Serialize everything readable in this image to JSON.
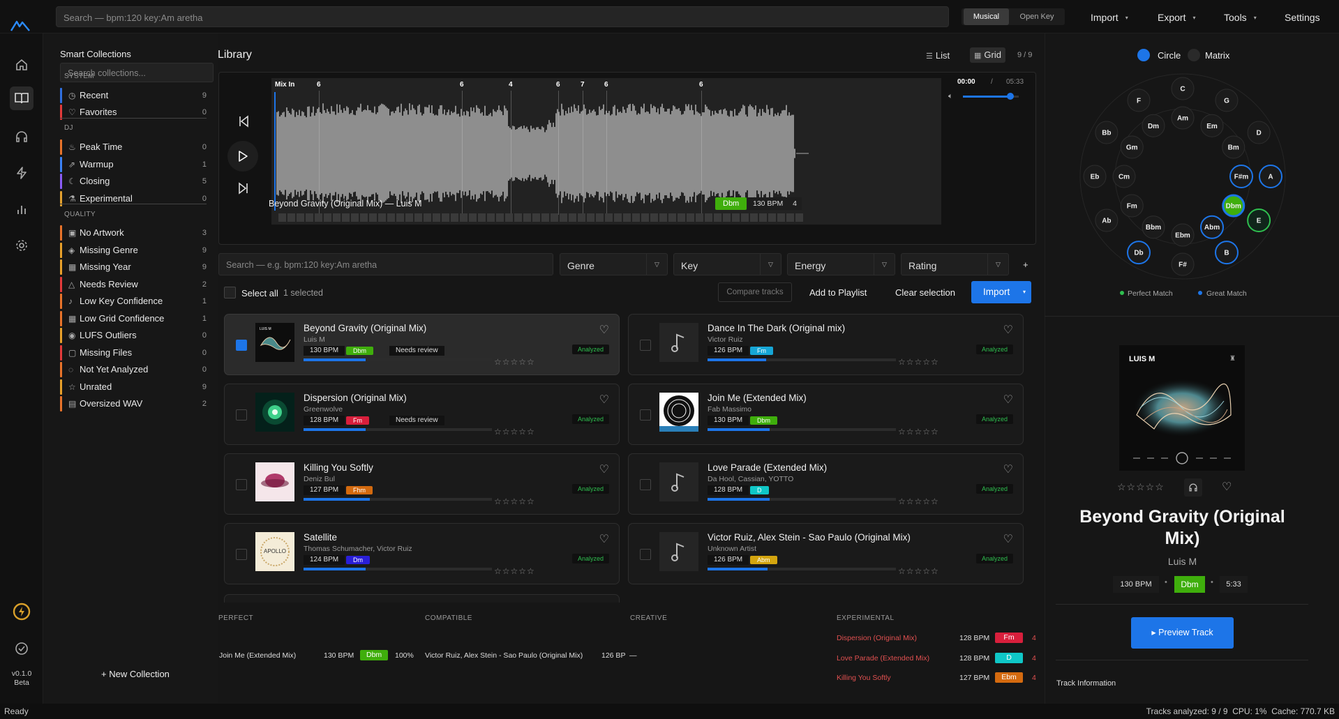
{
  "topbar": {
    "search_placeholder": "Search — bpm:120 key:Am aretha",
    "notation": {
      "musical": "Musical",
      "open_key": "Open Key"
    },
    "menus": [
      "Import",
      "Export",
      "Tools",
      "Settings"
    ]
  },
  "rail": {
    "items": [
      "home-icon",
      "library-icon",
      "headphones-icon",
      "bolt-icon",
      "chart-icon",
      "gear-icon"
    ],
    "version": "v0.1.0",
    "channel": "Beta"
  },
  "collections": {
    "title": "Smart Collections",
    "search_placeholder": "Search collections...",
    "sections": [
      {
        "name": "SYSTEM",
        "items": [
          {
            "label": "Recent",
            "count": "9",
            "color": "#2f6fe0",
            "icon": "clock-icon"
          },
          {
            "label": "Favorites",
            "count": "0",
            "color": "#e33b3b",
            "icon": "heart-icon"
          }
        ]
      },
      {
        "name": "DJ",
        "items": [
          {
            "label": "Peak Time",
            "count": "0",
            "color": "#e8732a",
            "icon": "flame-icon"
          },
          {
            "label": "Warmup",
            "count": "1",
            "color": "#3b82f6",
            "icon": "chart-icon"
          },
          {
            "label": "Closing",
            "count": "5",
            "color": "#8b5cf6",
            "icon": "moon-icon"
          },
          {
            "label": "Experimental",
            "count": "0",
            "color": "#e3a12f",
            "icon": "flask-icon"
          }
        ]
      },
      {
        "name": "QUALITY",
        "items": [
          {
            "label": "No Artwork",
            "count": "3",
            "color": "#e8732a",
            "icon": "image-icon"
          },
          {
            "label": "Missing Genre",
            "count": "9",
            "color": "#e8a02a",
            "icon": "tag-icon"
          },
          {
            "label": "Missing Year",
            "count": "9",
            "color": "#e8a02a",
            "icon": "calendar-icon"
          },
          {
            "label": "Needs Review",
            "count": "2",
            "color": "#e33b3b",
            "icon": "warning-icon"
          },
          {
            "label": "Low Key Confidence",
            "count": "1",
            "color": "#e8732a",
            "icon": "note-icon"
          },
          {
            "label": "Low Grid Confidence",
            "count": "1",
            "color": "#e8732a",
            "icon": "grid-icon"
          },
          {
            "label": "LUFS Outliers",
            "count": "0",
            "color": "#e8a02a",
            "icon": "volume-icon"
          },
          {
            "label": "Missing Files",
            "count": "0",
            "color": "#e33b3b",
            "icon": "file-icon"
          },
          {
            "label": "Not Yet Analyzed",
            "count": "0",
            "color": "#e8732a",
            "icon": "scan-icon"
          },
          {
            "label": "Unrated",
            "count": "9",
            "color": "#e8a02a",
            "icon": "star-icon"
          },
          {
            "label": "Oversized WAV",
            "count": "2",
            "color": "#e8732a",
            "icon": "box-icon"
          }
        ]
      }
    ],
    "new_collection": "+ New Collection"
  },
  "library": {
    "title": "Library",
    "view_list": "List",
    "view_grid": "Grid",
    "count": "9 / 9",
    "player": {
      "mix_in": "Mix In",
      "cue_markers": [
        "6",
        "6",
        "4",
        "6",
        "7",
        "6",
        "6"
      ],
      "time_current": "00:00",
      "time_sep": "/",
      "time_total": "05:33",
      "volume": 0.85,
      "now_playing": "Beyond Gravity (Original Mix) — Luis M",
      "key": "Dbm",
      "bpm": "130 BPM",
      "beats": "4"
    },
    "filters": {
      "search_placeholder": "Search — e.g. bpm:120 key:Am aretha",
      "genre": "Genre",
      "key": "Key",
      "energy": "Energy",
      "rating": "Rating",
      "add": "+"
    },
    "actions": {
      "select_all": "Select all",
      "selected": "1 selected",
      "compare": "Compare tracks",
      "add_playlist": "Add to Playlist",
      "clear": "Clear selection",
      "import": "Import"
    },
    "tracks": [
      {
        "title": "Beyond Gravity (Original Mix)",
        "artist": "Luis M",
        "bpm": "130 BPM",
        "key": "Dbm",
        "key_color": "#3fae0c",
        "review": "Needs review",
        "status": "Analyzed",
        "progress": 0.33,
        "selected": true,
        "art": "abstract"
      },
      {
        "title": "Dance In The Dark (Original mix)",
        "artist": "Victor Ruiz",
        "bpm": "126 BPM",
        "key": "Fm",
        "key_color": "#16a6d6",
        "review": "",
        "status": "Analyzed",
        "progress": 0.31,
        "selected": false,
        "art": "none"
      },
      {
        "title": "Dispersion (Original Mix)",
        "artist": "Greenwolve",
        "bpm": "128 BPM",
        "key": "Fm",
        "key_color": "#d81f3c",
        "review": "Needs review",
        "status": "Analyzed",
        "progress": 0.33,
        "selected": false,
        "art": "green"
      },
      {
        "title": "Join Me (Extended Mix)",
        "artist": "Fab Massimo",
        "bpm": "130 BPM",
        "key": "Dbm",
        "key_color": "#3fae0c",
        "review": "",
        "status": "Analyzed",
        "progress": 0.33,
        "selected": false,
        "art": "circle"
      },
      {
        "title": "Killing You Softly",
        "artist": "Deniz Bul",
        "bpm": "127 BPM",
        "key": "Fhm",
        "key_color": "#d46a0f",
        "review": "",
        "status": "Analyzed",
        "progress": 0.35,
        "selected": false,
        "art": "pink"
      },
      {
        "title": "Love Parade (Extended Mix)",
        "artist": "Da Hool, Cassian, YOTTO",
        "bpm": "128 BPM",
        "key": "D",
        "key_color": "#0fc7c7",
        "review": "",
        "status": "Analyzed",
        "progress": 0.33,
        "selected": false,
        "art": "none"
      },
      {
        "title": "Satellite",
        "artist": "Thomas Schumacher, Victor Ruiz",
        "bpm": "124 BPM",
        "key": "Dm",
        "key_color": "#2a1fd8",
        "review": "",
        "status": "Analyzed",
        "progress": 0.33,
        "selected": false,
        "art": "apollo"
      },
      {
        "title": "Victor Ruiz, Alex Stein - Sao Paulo (Original Mix)",
        "artist": "Unknown Artist",
        "bpm": "126 BPM",
        "key": "Abm",
        "key_color": "#d4a50f",
        "review": "",
        "status": "Analyzed",
        "progress": 0.32,
        "selected": false,
        "art": "none"
      }
    ],
    "apollo_text": "APOLLO"
  },
  "suggestions": {
    "headers": [
      "PERFECT",
      "COMPATIBLE",
      "CREATIVE",
      "EXPERIMENTAL"
    ],
    "perfect": {
      "title": "Join Me (Extended Mix)",
      "bpm": "130 BPM",
      "key": "Dbm",
      "key_color": "#3fae0c",
      "score": "100%"
    },
    "compatible": {
      "title": "Victor Ruiz, Alex Stein - Sao Paulo (Original Mix)",
      "bpm": "126 BP",
      "rest": "—"
    },
    "experimental": [
      {
        "title": "Dispersion (Original Mix)",
        "bpm": "128 BPM",
        "key": "Fm",
        "key_color": "#d81f3c",
        "score": "4"
      },
      {
        "title": "Love Parade (Extended Mix)",
        "bpm": "128 BPM",
        "key": "D",
        "key_color": "#0fc7c7",
        "score": "4"
      },
      {
        "title": "Killing You Softly",
        "bpm": "127 BPM",
        "key": "Ebm",
        "key_color": "#d46a0f",
        "score": "4"
      }
    ]
  },
  "wheel": {
    "mode_circle": "Circle",
    "mode_matrix": "Matrix",
    "outer": [
      "C",
      "G",
      "D",
      "A",
      "E",
      "B",
      "F#",
      "Db",
      "Ab",
      "Eb",
      "Bb",
      "F"
    ],
    "inner": [
      "Am",
      "Em",
      "Bm",
      "F#m",
      "Dbm",
      "Abm",
      "Ebm",
      "Bbm",
      "Fm",
      "Cm",
      "Gm",
      "Dm"
    ],
    "legend_perfect": "Perfect Match",
    "legend_great": "Great Match"
  },
  "detail": {
    "art_label": "LUIS M",
    "title": "Beyond Gravity (Original Mix)",
    "artist": "Luis M",
    "bpm": "130 BPM",
    "key": "Dbm",
    "duration": "5:33",
    "dot": "•",
    "preview": "▸ Preview Track",
    "info_header": "Track Information"
  },
  "status": {
    "left": "Ready",
    "right": "Tracks analyzed: 9 / 9  CPU: 1%  Cache: 770.7 KB"
  },
  "colors": {
    "accent": "#1d75e8",
    "green": "#3fae0c",
    "perfect": "#2fbf4f",
    "great": "#1d75e8"
  }
}
